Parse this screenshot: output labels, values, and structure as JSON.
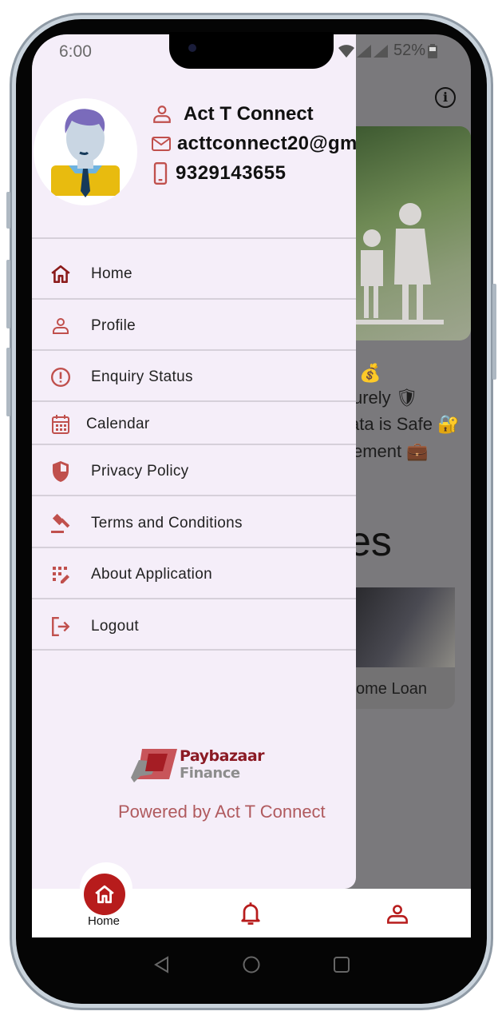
{
  "status_bar": {
    "time": "6:00",
    "battery": "52%"
  },
  "profile": {
    "name": "Act T Connect",
    "email": "acttconnect20@gm",
    "phone": "9329143655"
  },
  "menu": [
    {
      "label": "Home",
      "icon": "home-icon"
    },
    {
      "label": "Profile",
      "icon": "person-icon"
    },
    {
      "label": "Enquiry Status",
      "icon": "alert-circle-icon"
    },
    {
      "label": "Calendar",
      "icon": "calendar-icon"
    },
    {
      "label": "Privacy Policy",
      "icon": "shield-icon"
    },
    {
      "label": "Terms and Conditions",
      "icon": "gavel-icon"
    },
    {
      "label": "About Application",
      "icon": "app-grid-icon"
    },
    {
      "label": "Logout",
      "icon": "logout-icon"
    }
  ],
  "logo": {
    "line1": "Paybazaar",
    "line2": "Finance"
  },
  "powered_by": "Powered by Act T Connect",
  "background": {
    "line1": "urely 🛡",
    "line2": "ata is Safe 🔐",
    "line3": "ement 💼",
    "money_emoji": "💰",
    "heading": "es",
    "card_label": "ome Loan"
  },
  "bottom_nav": {
    "home_label": "Home"
  },
  "colors": {
    "accent": "#b71c1c",
    "drawer_bg": "#f5eef9",
    "overlay": "#7a797c"
  }
}
